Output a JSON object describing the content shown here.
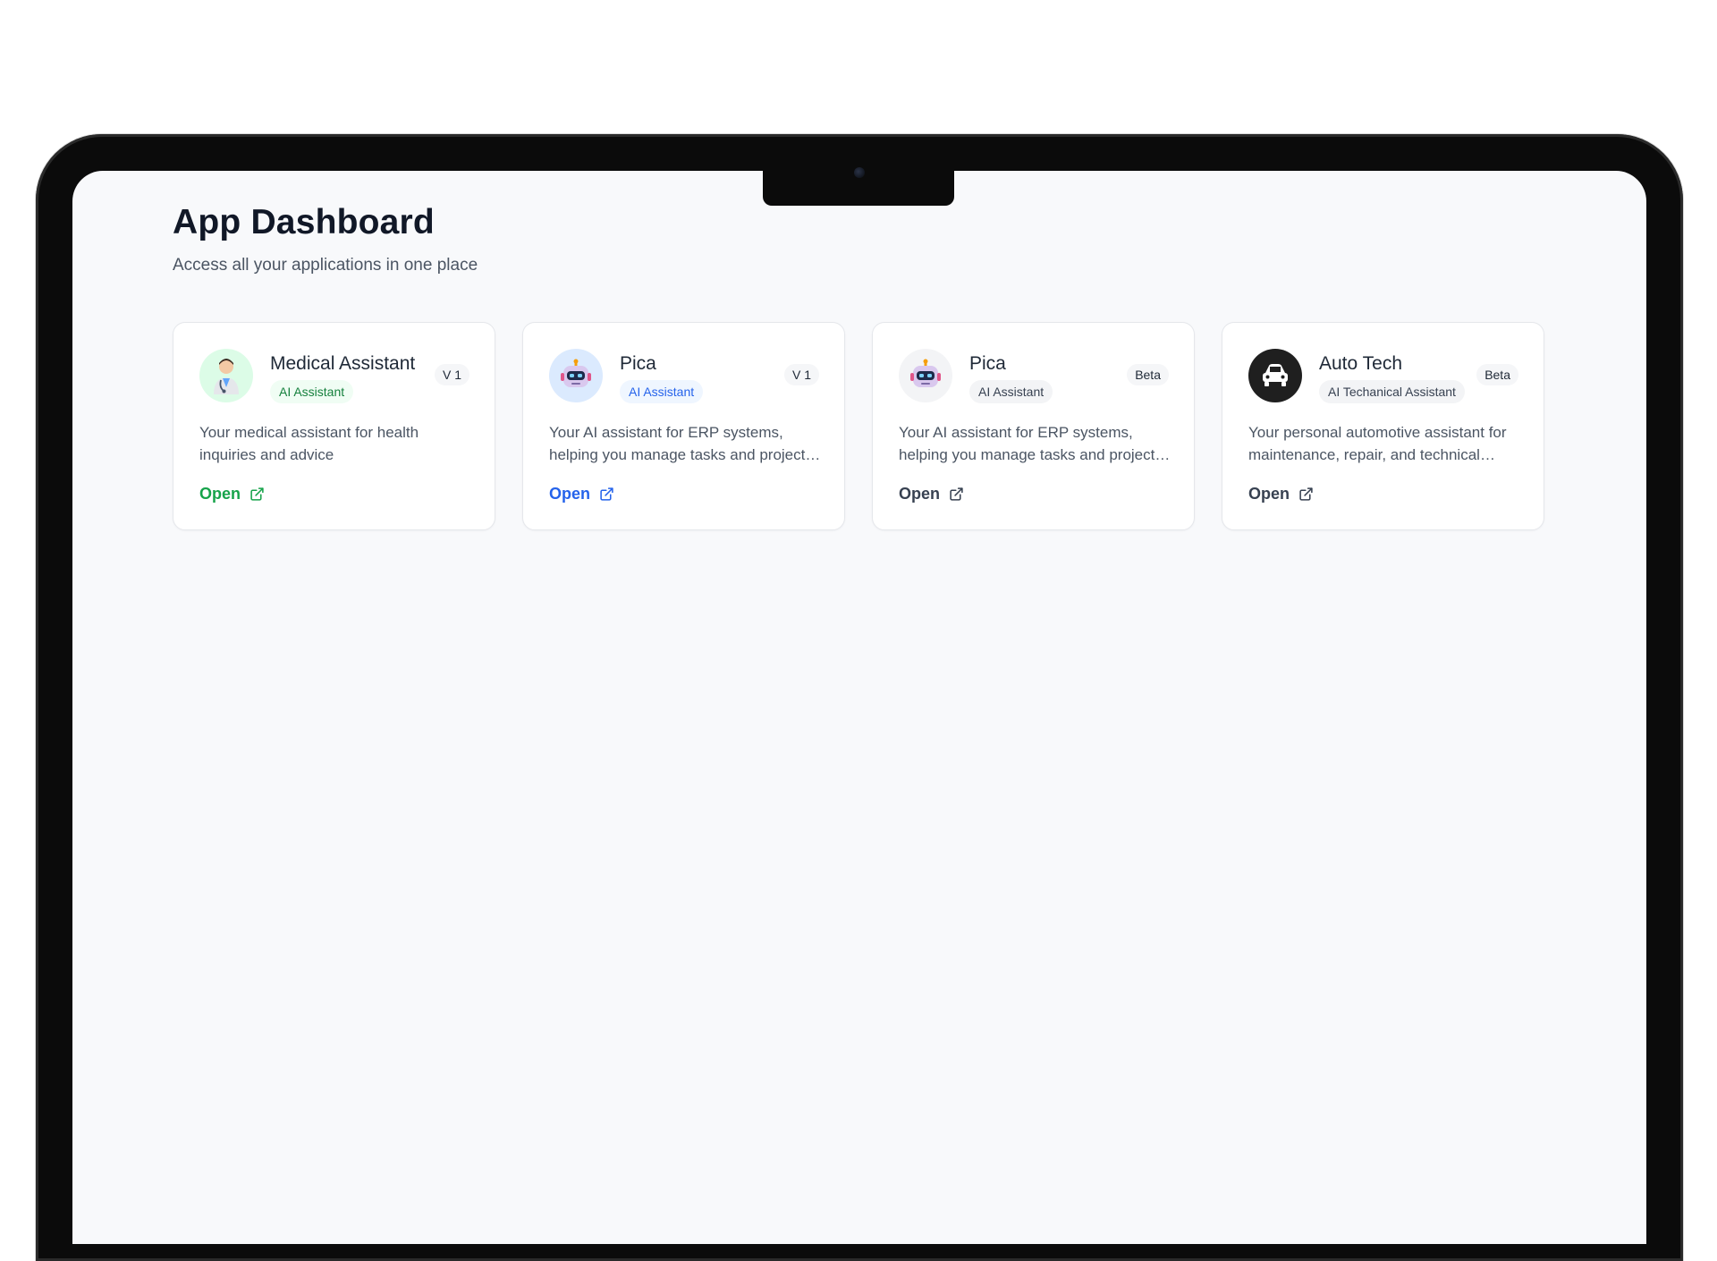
{
  "header": {
    "title": "App Dashboard",
    "subtitle": "Access all your applications in one place"
  },
  "apps": [
    {
      "name": "Medical Assistant",
      "tag": "AI Assistant",
      "badge": "V 1",
      "description": "Your medical assistant for health inquiries and advice",
      "open_label": "Open",
      "icon": "doctor-icon",
      "accent": "#16a34a"
    },
    {
      "name": "Pica",
      "tag": "AI Assistant",
      "badge": "V 1",
      "description": "Your AI assistant for ERP systems, helping you manage tasks and projects efficiently",
      "open_label": "Open",
      "icon": "robot-icon",
      "accent": "#2563eb"
    },
    {
      "name": "Pica",
      "tag": "AI Assistant",
      "badge": "Beta",
      "description": "Your AI assistant for ERP systems, helping you manage tasks and projects efficiently",
      "open_label": "Open",
      "icon": "robot-icon",
      "accent": "#374151"
    },
    {
      "name": "Auto Tech",
      "tag": "AI Techanical Assistant",
      "badge": "Beta",
      "description": "Your personal automotive assistant for maintenance, repair, and technical support",
      "open_label": "Open",
      "icon": "car-icon",
      "accent": "#374151"
    }
  ]
}
